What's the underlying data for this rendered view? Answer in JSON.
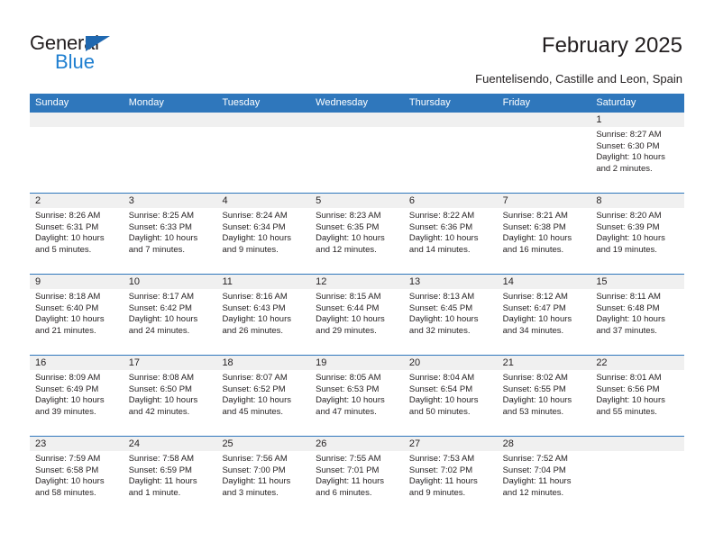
{
  "brand": {
    "name_part1": "General",
    "name_part2": "Blue",
    "triangle_color": "#1f68b0",
    "blue_color": "#1f7fd0"
  },
  "header": {
    "title": "February 2025",
    "subtitle": "Fuentelisendo, Castille and Leon, Spain"
  },
  "calendar": {
    "header_color": "#2f77bc",
    "cell_head_color": "#f0f0f0",
    "day_names": [
      "Sunday",
      "Monday",
      "Tuesday",
      "Wednesday",
      "Thursday",
      "Friday",
      "Saturday"
    ],
    "weeks": [
      [
        {
          "day": "",
          "empty": true
        },
        {
          "day": "",
          "empty": true
        },
        {
          "day": "",
          "empty": true
        },
        {
          "day": "",
          "empty": true
        },
        {
          "day": "",
          "empty": true
        },
        {
          "day": "",
          "empty": true
        },
        {
          "day": "1",
          "sunrise": "Sunrise: 8:27 AM",
          "sunset": "Sunset: 6:30 PM",
          "daylight": "Daylight: 10 hours and 2 minutes."
        }
      ],
      [
        {
          "day": "2",
          "sunrise": "Sunrise: 8:26 AM",
          "sunset": "Sunset: 6:31 PM",
          "daylight": "Daylight: 10 hours and 5 minutes."
        },
        {
          "day": "3",
          "sunrise": "Sunrise: 8:25 AM",
          "sunset": "Sunset: 6:33 PM",
          "daylight": "Daylight: 10 hours and 7 minutes."
        },
        {
          "day": "4",
          "sunrise": "Sunrise: 8:24 AM",
          "sunset": "Sunset: 6:34 PM",
          "daylight": "Daylight: 10 hours and 9 minutes."
        },
        {
          "day": "5",
          "sunrise": "Sunrise: 8:23 AM",
          "sunset": "Sunset: 6:35 PM",
          "daylight": "Daylight: 10 hours and 12 minutes."
        },
        {
          "day": "6",
          "sunrise": "Sunrise: 8:22 AM",
          "sunset": "Sunset: 6:36 PM",
          "daylight": "Daylight: 10 hours and 14 minutes."
        },
        {
          "day": "7",
          "sunrise": "Sunrise: 8:21 AM",
          "sunset": "Sunset: 6:38 PM",
          "daylight": "Daylight: 10 hours and 16 minutes."
        },
        {
          "day": "8",
          "sunrise": "Sunrise: 8:20 AM",
          "sunset": "Sunset: 6:39 PM",
          "daylight": "Daylight: 10 hours and 19 minutes."
        }
      ],
      [
        {
          "day": "9",
          "sunrise": "Sunrise: 8:18 AM",
          "sunset": "Sunset: 6:40 PM",
          "daylight": "Daylight: 10 hours and 21 minutes."
        },
        {
          "day": "10",
          "sunrise": "Sunrise: 8:17 AM",
          "sunset": "Sunset: 6:42 PM",
          "daylight": "Daylight: 10 hours and 24 minutes."
        },
        {
          "day": "11",
          "sunrise": "Sunrise: 8:16 AM",
          "sunset": "Sunset: 6:43 PM",
          "daylight": "Daylight: 10 hours and 26 minutes."
        },
        {
          "day": "12",
          "sunrise": "Sunrise: 8:15 AM",
          "sunset": "Sunset: 6:44 PM",
          "daylight": "Daylight: 10 hours and 29 minutes."
        },
        {
          "day": "13",
          "sunrise": "Sunrise: 8:13 AM",
          "sunset": "Sunset: 6:45 PM",
          "daylight": "Daylight: 10 hours and 32 minutes."
        },
        {
          "day": "14",
          "sunrise": "Sunrise: 8:12 AM",
          "sunset": "Sunset: 6:47 PM",
          "daylight": "Daylight: 10 hours and 34 minutes."
        },
        {
          "day": "15",
          "sunrise": "Sunrise: 8:11 AM",
          "sunset": "Sunset: 6:48 PM",
          "daylight": "Daylight: 10 hours and 37 minutes."
        }
      ],
      [
        {
          "day": "16",
          "sunrise": "Sunrise: 8:09 AM",
          "sunset": "Sunset: 6:49 PM",
          "daylight": "Daylight: 10 hours and 39 minutes."
        },
        {
          "day": "17",
          "sunrise": "Sunrise: 8:08 AM",
          "sunset": "Sunset: 6:50 PM",
          "daylight": "Daylight: 10 hours and 42 minutes."
        },
        {
          "day": "18",
          "sunrise": "Sunrise: 8:07 AM",
          "sunset": "Sunset: 6:52 PM",
          "daylight": "Daylight: 10 hours and 45 minutes."
        },
        {
          "day": "19",
          "sunrise": "Sunrise: 8:05 AM",
          "sunset": "Sunset: 6:53 PM",
          "daylight": "Daylight: 10 hours and 47 minutes."
        },
        {
          "day": "20",
          "sunrise": "Sunrise: 8:04 AM",
          "sunset": "Sunset: 6:54 PM",
          "daylight": "Daylight: 10 hours and 50 minutes."
        },
        {
          "day": "21",
          "sunrise": "Sunrise: 8:02 AM",
          "sunset": "Sunset: 6:55 PM",
          "daylight": "Daylight: 10 hours and 53 minutes."
        },
        {
          "day": "22",
          "sunrise": "Sunrise: 8:01 AM",
          "sunset": "Sunset: 6:56 PM",
          "daylight": "Daylight: 10 hours and 55 minutes."
        }
      ],
      [
        {
          "day": "23",
          "sunrise": "Sunrise: 7:59 AM",
          "sunset": "Sunset: 6:58 PM",
          "daylight": "Daylight: 10 hours and 58 minutes."
        },
        {
          "day": "24",
          "sunrise": "Sunrise: 7:58 AM",
          "sunset": "Sunset: 6:59 PM",
          "daylight": "Daylight: 11 hours and 1 minute."
        },
        {
          "day": "25",
          "sunrise": "Sunrise: 7:56 AM",
          "sunset": "Sunset: 7:00 PM",
          "daylight": "Daylight: 11 hours and 3 minutes."
        },
        {
          "day": "26",
          "sunrise": "Sunrise: 7:55 AM",
          "sunset": "Sunset: 7:01 PM",
          "daylight": "Daylight: 11 hours and 6 minutes."
        },
        {
          "day": "27",
          "sunrise": "Sunrise: 7:53 AM",
          "sunset": "Sunset: 7:02 PM",
          "daylight": "Daylight: 11 hours and 9 minutes."
        },
        {
          "day": "28",
          "sunrise": "Sunrise: 7:52 AM",
          "sunset": "Sunset: 7:04 PM",
          "daylight": "Daylight: 11 hours and 12 minutes."
        },
        {
          "day": "",
          "empty": true
        }
      ]
    ]
  }
}
